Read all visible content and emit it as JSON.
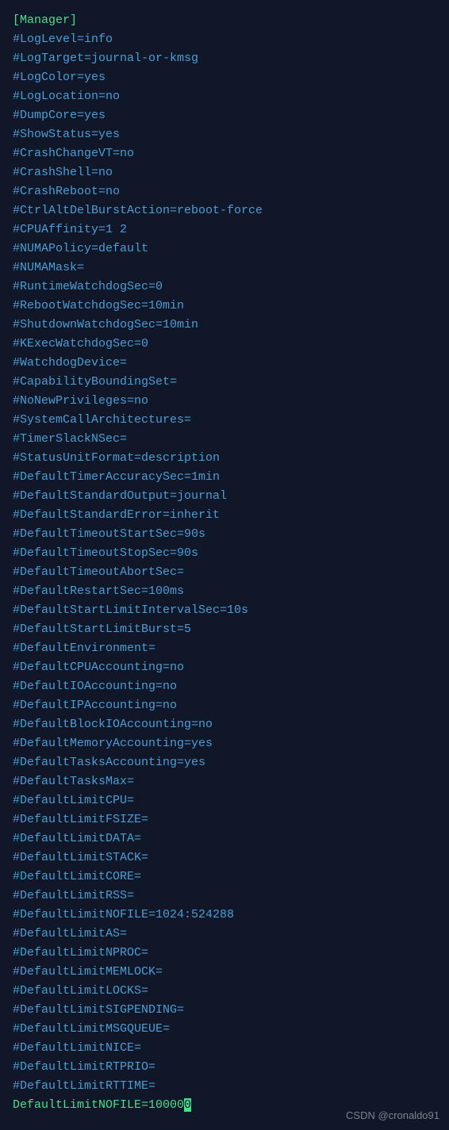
{
  "sectionHeader": "[Manager]",
  "lines": [
    "#LogLevel=info",
    "#LogTarget=journal-or-kmsg",
    "#LogColor=yes",
    "#LogLocation=no",
    "#DumpCore=yes",
    "#ShowStatus=yes",
    "#CrashChangeVT=no",
    "#CrashShell=no",
    "#CrashReboot=no",
    "#CtrlAltDelBurstAction=reboot-force",
    "#CPUAffinity=1 2",
    "#NUMAPolicy=default",
    "#NUMAMask=",
    "#RuntimeWatchdogSec=0",
    "#RebootWatchdogSec=10min",
    "#ShutdownWatchdogSec=10min",
    "#KExecWatchdogSec=0",
    "#WatchdogDevice=",
    "#CapabilityBoundingSet=",
    "#NoNewPrivileges=no",
    "#SystemCallArchitectures=",
    "#TimerSlackNSec=",
    "#StatusUnitFormat=description",
    "#DefaultTimerAccuracySec=1min",
    "#DefaultStandardOutput=journal",
    "#DefaultStandardError=inherit",
    "#DefaultTimeoutStartSec=90s",
    "#DefaultTimeoutStopSec=90s",
    "#DefaultTimeoutAbortSec=",
    "#DefaultRestartSec=100ms",
    "#DefaultStartLimitIntervalSec=10s",
    "#DefaultStartLimitBurst=5",
    "#DefaultEnvironment=",
    "#DefaultCPUAccounting=no",
    "#DefaultIOAccounting=no",
    "#DefaultIPAccounting=no",
    "#DefaultBlockIOAccounting=no",
    "#DefaultMemoryAccounting=yes",
    "#DefaultTasksAccounting=yes",
    "#DefaultTasksMax=",
    "#DefaultLimitCPU=",
    "#DefaultLimitFSIZE=",
    "#DefaultLimitDATA=",
    "#DefaultLimitSTACK=",
    "#DefaultLimitCORE=",
    "#DefaultLimitRSS=",
    "#DefaultLimitNOFILE=1024:524288",
    "#DefaultLimitAS=",
    "#DefaultLimitNPROC=",
    "#DefaultLimitMEMLOCK=",
    "#DefaultLimitLOCKS=",
    "#DefaultLimitSIGPENDING=",
    "#DefaultLimitMSGQUEUE=",
    "#DefaultLimitNICE=",
    "#DefaultLimitRTPRIO=",
    "#DefaultLimitRTTIME="
  ],
  "activeLine": {
    "prefix": "DefaultLimitNOFILE=10000",
    "cursorChar": "0"
  },
  "watermark": "CSDN @cronaldo91"
}
